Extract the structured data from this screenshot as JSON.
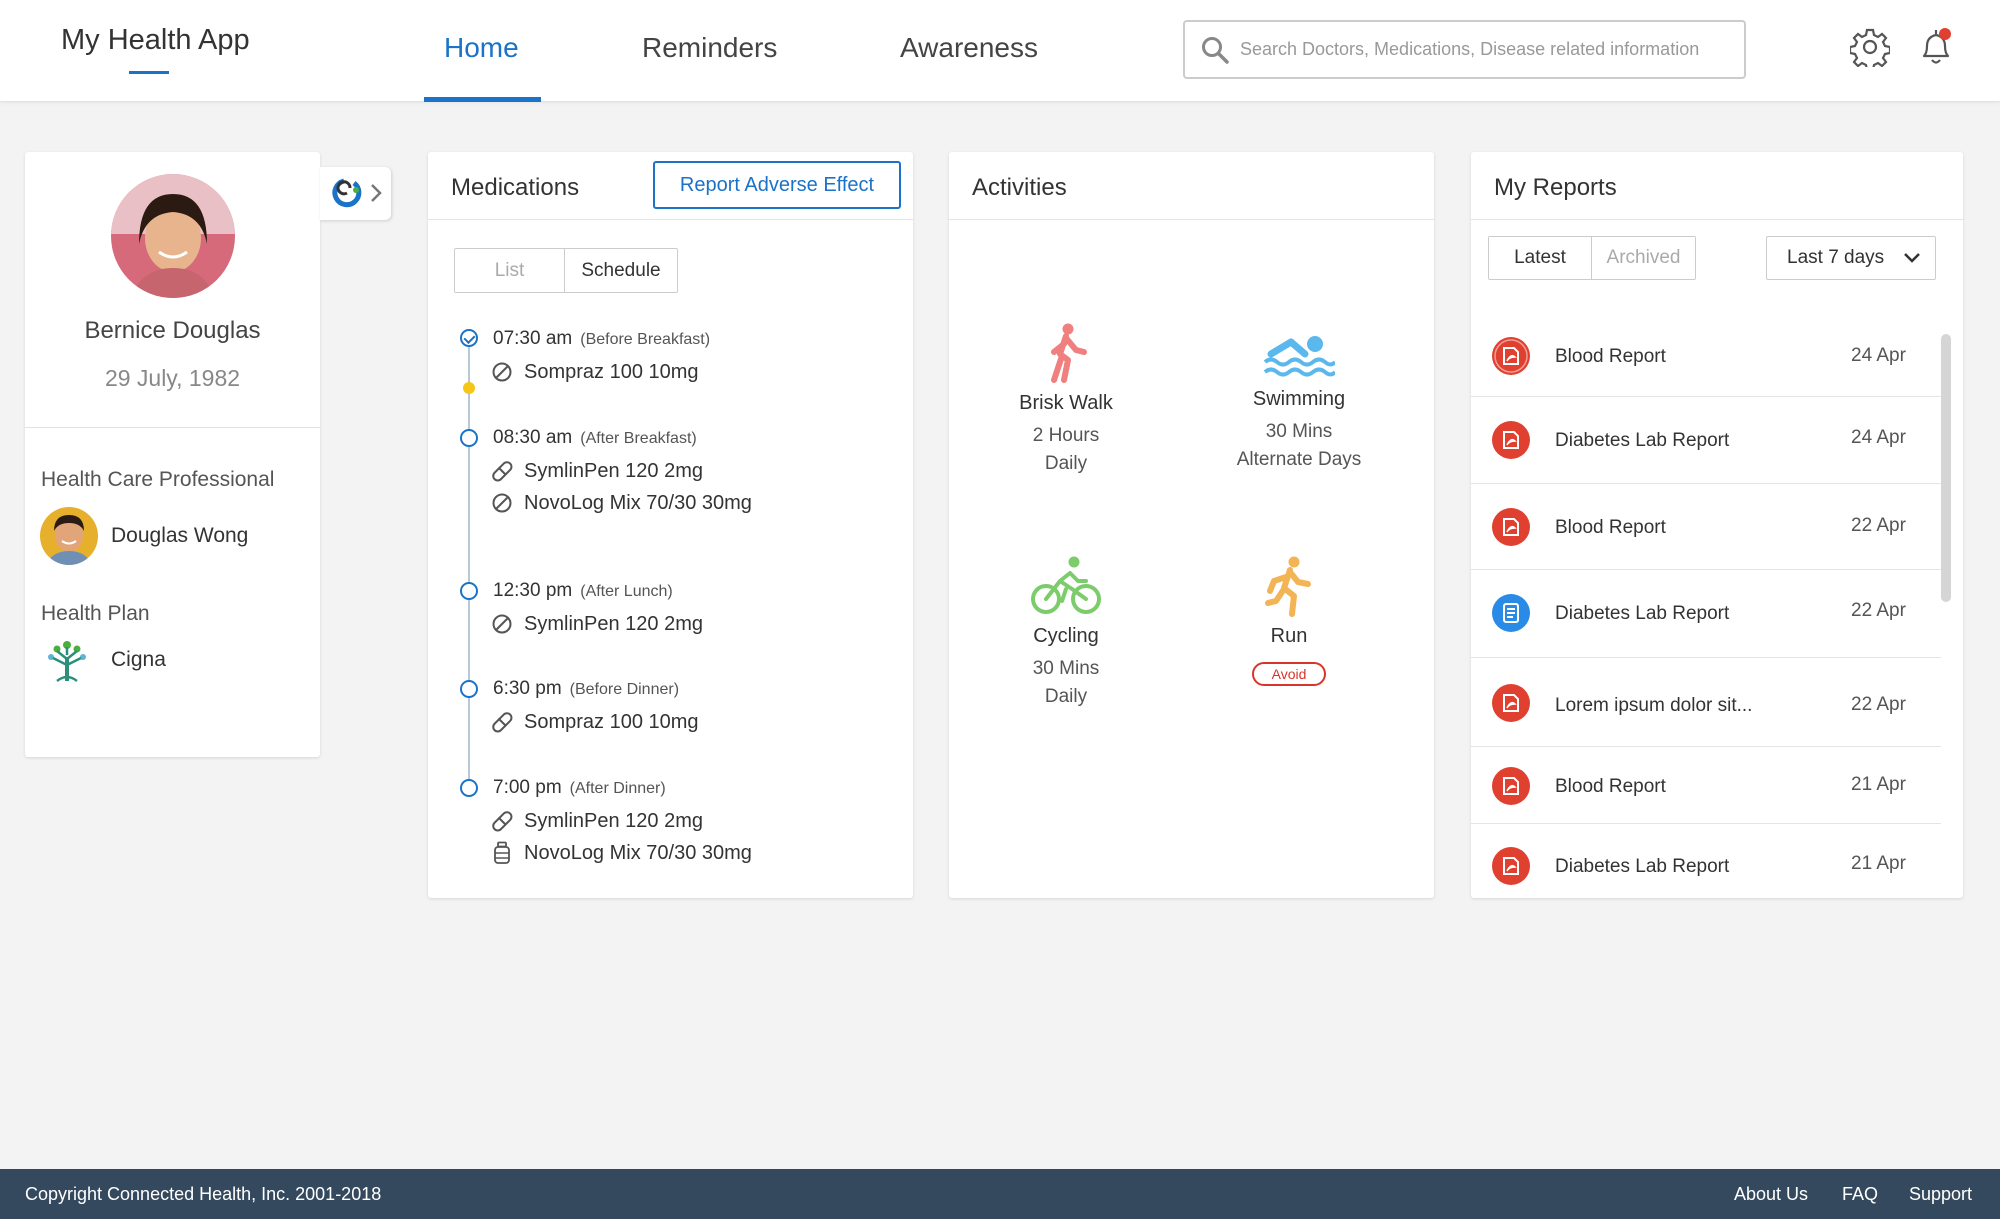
{
  "header": {
    "brand": "My Health App",
    "tabs": [
      {
        "label": "Home",
        "active": true
      },
      {
        "label": "Reminders",
        "active": false
      },
      {
        "label": "Awareness",
        "active": false
      }
    ],
    "search_placeholder": "Search Doctors, Medications, Disease related information"
  },
  "profile": {
    "name": "Bernice Douglas",
    "dob": "29 July, 1982",
    "hcp_label": "Health Care Professional",
    "hcp_name": "Douglas Wong",
    "plan_label": "Health Plan",
    "plan_name": "Cigna"
  },
  "medications": {
    "title": "Medications",
    "report_button": "Report Adverse Effect",
    "view_tabs": [
      {
        "label": "List",
        "active": false
      },
      {
        "label": "Schedule",
        "active": true
      }
    ],
    "schedule": [
      {
        "time": "07:30 am",
        "meal": "(Before Breakfast)",
        "done": true,
        "meds": [
          {
            "name": "Sompraz 100 10mg",
            "icon": "tablet-icon"
          }
        ]
      },
      {
        "time": "08:30 am",
        "meal": "(After Breakfast)",
        "done": false,
        "meds": [
          {
            "name": "SymlinPen 120 2mg",
            "icon": "capsule-icon"
          },
          {
            "name": "NovoLog Mix 70/30 30mg",
            "icon": "tablet-icon"
          }
        ]
      },
      {
        "time": "12:30 pm",
        "meal": "(After Lunch)",
        "done": false,
        "meds": [
          {
            "name": "SymlinPen 120 2mg",
            "icon": "tablet-icon"
          }
        ]
      },
      {
        "time": "6:30 pm",
        "meal": "(Before Dinner)",
        "done": false,
        "meds": [
          {
            "name": "Sompraz 100 10mg",
            "icon": "capsule-icon"
          }
        ]
      },
      {
        "time": "7:00 pm",
        "meal": "(After Dinner)",
        "done": false,
        "meds": [
          {
            "name": "SymlinPen 120 2mg",
            "icon": "capsule-icon"
          },
          {
            "name": "NovoLog Mix 70/30 30mg",
            "icon": "bottle-icon"
          }
        ]
      }
    ]
  },
  "activities": {
    "title": "Activities",
    "items": [
      {
        "name": "Brisk Walk",
        "line1": "2 Hours",
        "line2": "Daily",
        "icon": "walk-icon",
        "color": "#f07f7f"
      },
      {
        "name": "Swimming",
        "line1": "30 Mins",
        "line2": "Alternate Days",
        "icon": "swim-icon",
        "color": "#5bb8ec"
      },
      {
        "name": "Cycling",
        "line1": "30 Mins",
        "line2": "Daily",
        "icon": "cycle-icon",
        "color": "#7ccc6c"
      },
      {
        "name": "Run",
        "badge": "Avoid",
        "icon": "run-icon",
        "color": "#f3b456"
      }
    ]
  },
  "reports": {
    "title": "My Reports",
    "tabs": [
      {
        "label": "Latest",
        "active": true
      },
      {
        "label": "Archived",
        "active": false
      }
    ],
    "range": "Last 7 days",
    "items": [
      {
        "name": "Blood Report",
        "date": "24 Apr",
        "type": "pdf"
      },
      {
        "name": "Diabetes Lab Report",
        "date": "24 Apr",
        "type": "pdf"
      },
      {
        "name": "Blood Report",
        "date": "22 Apr",
        "type": "pdf"
      },
      {
        "name": "Diabetes Lab Report",
        "date": "22 Apr",
        "type": "doc"
      },
      {
        "name": "Lorem ipsum dolor sit...",
        "date": "22 Apr",
        "type": "pdf"
      },
      {
        "name": "Blood Report",
        "date": "21 Apr",
        "type": "pdf"
      },
      {
        "name": "Diabetes Lab Report",
        "date": "21 Apr",
        "type": "pdf"
      }
    ]
  },
  "footer": {
    "copyright": "Copyright Connected Health, Inc. 2001-2018",
    "links": [
      "About Us",
      "FAQ",
      "Support"
    ]
  },
  "colors": {
    "accent": "#1a73c8",
    "pdf": "#e0402f",
    "doc": "#2a8be6",
    "footer": "#34495e",
    "now": "#f5c518"
  }
}
